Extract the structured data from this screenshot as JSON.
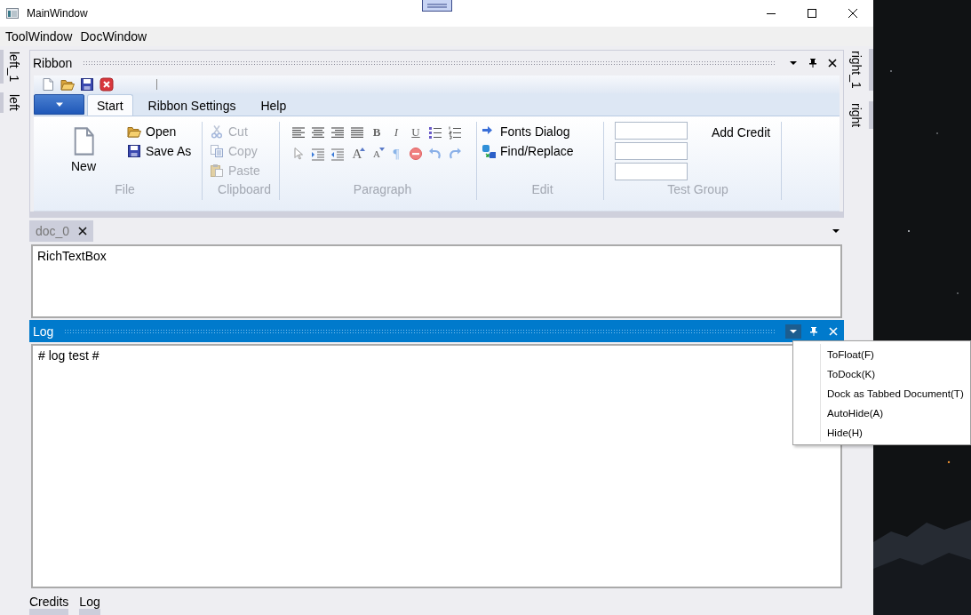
{
  "window": {
    "title": "MainWindow"
  },
  "menu": [
    {
      "label": "ToolWindow"
    },
    {
      "label": "DocWindow"
    }
  ],
  "left_tabs": [
    {
      "label": "left_1"
    },
    {
      "label": "left"
    }
  ],
  "right_tabs": [
    {
      "label": "right_1"
    },
    {
      "label": "right"
    }
  ],
  "ribbon_pane": {
    "title": "Ribbon",
    "active": false,
    "tabs": [
      {
        "label": "Start",
        "selected": true
      },
      {
        "label": "Ribbon Settings",
        "selected": false
      },
      {
        "label": "Help",
        "selected": false
      }
    ],
    "groups": [
      {
        "title": "File",
        "items": [
          {
            "kind": "large",
            "label": "New",
            "disabled": false
          },
          {
            "kind": "small",
            "label": "Open",
            "disabled": false
          },
          {
            "kind": "small",
            "label": "Save As",
            "disabled": false
          }
        ]
      },
      {
        "title": "Clipboard",
        "items": [
          {
            "kind": "small",
            "label": "Cut",
            "disabled": true
          },
          {
            "kind": "small",
            "label": "Copy",
            "disabled": true
          },
          {
            "kind": "small",
            "label": "Paste",
            "disabled": true
          }
        ]
      },
      {
        "title": "Paragraph",
        "items": [
          {
            "kind": "icon"
          },
          {
            "kind": "icon"
          },
          {
            "kind": "icon"
          },
          {
            "kind": "icon"
          },
          {
            "kind": "bold",
            "text": "B"
          },
          {
            "kind": "italic",
            "text": "I"
          },
          {
            "kind": "underline",
            "text": "U"
          },
          {
            "kind": "icon"
          },
          {
            "kind": "icon"
          },
          {
            "kind": "icon"
          },
          {
            "kind": "icon"
          },
          {
            "kind": "icon"
          },
          {
            "kind": "grow",
            "text": "A"
          },
          {
            "kind": "shrink",
            "text": "A"
          },
          {
            "kind": "mark",
            "text": "¶"
          },
          {
            "kind": "icon"
          },
          {
            "kind": "icon"
          },
          {
            "kind": "icon"
          }
        ]
      },
      {
        "title": "Edit",
        "items": [
          {
            "kind": "small",
            "label": "Fonts Dialog",
            "disabled": false
          },
          {
            "kind": "small",
            "label": "Find/Replace",
            "disabled": false
          }
        ]
      },
      {
        "title": "Test Group",
        "items": [
          {
            "kind": "field"
          },
          {
            "kind": "field"
          },
          {
            "kind": "field"
          },
          {
            "kind": "button",
            "label": "Add Credit"
          }
        ]
      }
    ]
  },
  "documents": {
    "tabs": [
      {
        "label": "doc_0",
        "selected": true
      }
    ],
    "content": "RichTextBox"
  },
  "log_pane": {
    "title": "Log",
    "active": true,
    "menu_open": true,
    "content": "# log test #",
    "menu": [
      {
        "label": "ToFloat(F)"
      },
      {
        "label": "ToDock(K)"
      },
      {
        "label": "Dock as Tabbed Document(T)"
      },
      {
        "label": "AutoHide(A)"
      },
      {
        "label": "Hide(H)"
      }
    ]
  },
  "autohide_tabs": [
    {
      "label": "Credits"
    },
    {
      "label": "Log"
    }
  ]
}
